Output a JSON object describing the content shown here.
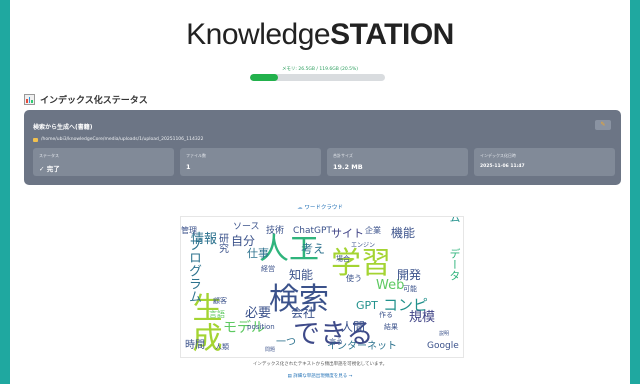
{
  "logo": {
    "light": "Knowledge",
    "bold": "STATION"
  },
  "memory": {
    "label": "メモリ: 26.5GB / 119.6GB (20.5%)",
    "percent": 20.5,
    "color": "#22b14c"
  },
  "section": {
    "title": "インデックス化ステータス",
    "icon": "bar-chart-icon"
  },
  "panel": {
    "title": "検索から生成へ(書籍)",
    "path": "/home/ubi3/knowledgeCore/media/uploads/1/upload_20251106_114322",
    "edit_icon": "pencil-icon",
    "cards": [
      {
        "label": "ステータス",
        "value": "✓ 完了"
      },
      {
        "label": "ファイル数",
        "value": "1"
      },
      {
        "label": "合計サイズ",
        "value": "19.2 MB"
      },
      {
        "label": "インデックス化日時",
        "value": "2025-11-06 11:47"
      }
    ]
  },
  "wordcloud": {
    "title": "ワードクラウド",
    "icon": "cloud-icon",
    "caption": "インデックス化されたテキストから頻出単語を可視化しています。",
    "link": "詳細な単語出現頻度を見る →",
    "words": [
      {
        "t": "生成",
        "s": 30,
        "c": "#a4d432",
        "v": 1
      },
      {
        "t": "検索",
        "s": 30,
        "c": "#3b528b",
        "v": 0
      },
      {
        "t": "学習",
        "s": 30,
        "c": "#a4d432",
        "v": 0
      },
      {
        "t": "人工",
        "s": 30,
        "c": "#2fb47c",
        "v": 0
      },
      {
        "t": "できる",
        "s": 27,
        "c": "#3e4a89",
        "v": 0
      },
      {
        "t": "知能",
        "s": 12,
        "c": "#3b528b",
        "v": 0
      },
      {
        "t": "情報",
        "s": 13,
        "c": "#2c728e",
        "v": 0
      },
      {
        "t": "自分",
        "s": 12,
        "c": "#3b528b",
        "v": 0
      },
      {
        "t": "仕事",
        "s": 11,
        "c": "#2c728e",
        "v": 0
      },
      {
        "t": "考え",
        "s": 12,
        "c": "#2c728e",
        "v": 0
      },
      {
        "t": "サイト",
        "s": 11,
        "c": "#414487",
        "v": 0
      },
      {
        "t": "機能",
        "s": 12,
        "c": "#3b528b",
        "v": 0
      },
      {
        "t": "プログラム",
        "s": 13,
        "c": "#2c728e",
        "v": 1
      },
      {
        "t": "Web",
        "s": 13,
        "c": "#5ec962",
        "v": 0
      },
      {
        "t": "開発",
        "s": 12,
        "c": "#3b528b",
        "v": 0
      },
      {
        "t": "コンピ",
        "s": 15,
        "c": "#21918c",
        "v": 0
      },
      {
        "t": "GPT",
        "s": 11,
        "c": "#21918c",
        "v": 0
      },
      {
        "t": "規模",
        "s": 13,
        "c": "#414487",
        "v": 0
      },
      {
        "t": "モデル",
        "s": 14,
        "c": "#5ec962",
        "v": 0
      },
      {
        "t": "必要",
        "s": 13,
        "c": "#3b528b",
        "v": 0
      },
      {
        "t": "会社",
        "s": 12,
        "c": "#3b528b",
        "v": 0
      },
      {
        "t": "人間",
        "s": 12,
        "c": "#3b528b",
        "v": 0
      },
      {
        "t": "一つ",
        "s": 10,
        "c": "#2c728e",
        "v": 0
      },
      {
        "t": "インターネット",
        "s": 10,
        "c": "#2c728e",
        "v": 0
      },
      {
        "t": "Google",
        "s": 9,
        "c": "#3b528b",
        "v": 0
      },
      {
        "t": "時間",
        "s": 10,
        "c": "#3b528b",
        "v": 0
      },
      {
        "t": "ChatGPT",
        "s": 9,
        "c": "#3b528b",
        "v": 0
      },
      {
        "t": "技術",
        "s": 9,
        "c": "#3b528b",
        "v": 0
      },
      {
        "t": "ソース",
        "s": 9,
        "c": "#3b528b",
        "v": 0
      },
      {
        "t": "管理",
        "s": 8,
        "c": "#3b528b",
        "v": 0
      },
      {
        "t": "企業",
        "s": 8,
        "c": "#3b528b",
        "v": 0
      },
      {
        "t": "経営",
        "s": 7,
        "c": "#3b528b",
        "v": 0
      },
      {
        "t": "顧客",
        "s": 7,
        "c": "#3b528b",
        "v": 0
      },
      {
        "t": "position",
        "s": 7,
        "c": "#3b528b",
        "v": 0
      },
      {
        "t": "使う",
        "s": 8,
        "c": "#3b528b",
        "v": 0
      },
      {
        "t": "言う",
        "s": 7,
        "c": "#3b528b",
        "v": 0
      },
      {
        "t": "場合",
        "s": 7,
        "c": "#3b528b",
        "v": 0
      },
      {
        "t": "作る",
        "s": 7,
        "c": "#3b528b",
        "v": 0
      },
      {
        "t": "可能",
        "s": 7,
        "c": "#3b528b",
        "v": 0
      },
      {
        "t": "ゲーム",
        "s": 11,
        "c": "#21918c",
        "v": 1
      },
      {
        "t": "データ",
        "s": 11,
        "c": "#2fb47c",
        "v": 1
      },
      {
        "t": "研究",
        "s": 10,
        "c": "#3b528b",
        "v": 1
      },
      {
        "t": "言語",
        "s": 8,
        "c": "#5ec962",
        "v": 0
      },
      {
        "t": "人類",
        "s": 7,
        "c": "#3b528b",
        "v": 0
      },
      {
        "t": "結果",
        "s": 7,
        "c": "#3b528b",
        "v": 0
      },
      {
        "t": "エンジン",
        "s": 6,
        "c": "#3b528b",
        "v": 0
      },
      {
        "t": "説明",
        "s": 5,
        "c": "#3b528b",
        "v": 0
      },
      {
        "t": "問題",
        "s": 5,
        "c": "#3b528b",
        "v": 0
      }
    ]
  }
}
